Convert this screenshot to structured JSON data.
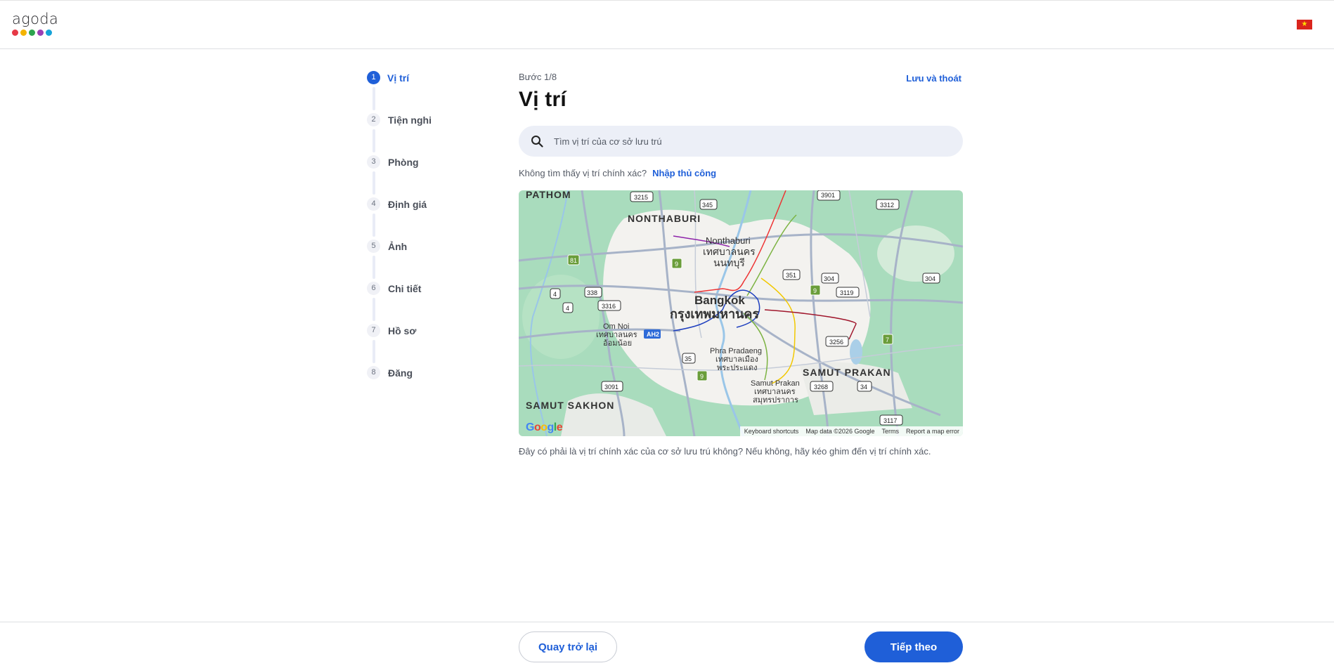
{
  "header": {
    "logo_text": "agoda",
    "logo_colors": [
      "#e63946",
      "#f4b400",
      "#2ea44f",
      "#9b3fb5",
      "#16a3d8"
    ],
    "flag": "vietnam-flag"
  },
  "stepper": {
    "steps": [
      {
        "num": "1",
        "label": "Vị trí",
        "active": true
      },
      {
        "num": "2",
        "label": "Tiện nghi"
      },
      {
        "num": "3",
        "label": "Phòng"
      },
      {
        "num": "4",
        "label": "Định giá"
      },
      {
        "num": "5",
        "label": "Ảnh"
      },
      {
        "num": "6",
        "label": "Chi tiết"
      },
      {
        "num": "7",
        "label": "Hồ sơ"
      },
      {
        "num": "8",
        "label": "Đăng"
      }
    ]
  },
  "main": {
    "step_counter": "Bước 1/8",
    "save_exit": "Lưu và thoát",
    "title": "Vị trí",
    "search_placeholder": "Tìm vị trí của cơ sở lưu trú",
    "not_found_text": "Không tìm thấy vị trí chính xác?",
    "manual_entry": "Nhập thủ công",
    "hint": "Đây có phải là vị trí chính xác của cơ sở lưu trú không? Nếu không, hãy kéo ghim đến vị trí chính xác."
  },
  "map": {
    "labels": {
      "pathom": "PATHOM",
      "nonthaburi_region": "NONTHABURI",
      "nonthaburi": "Nonthaburi",
      "nonthaburi_th1": "เทศบาลนคร",
      "nonthaburi_th2": "นนทบุรี",
      "bangkok": "Bangkok",
      "bangkok_th": "กรุงเทพมหานคร",
      "om_noi": "Om Noi",
      "om_noi_th1": "เทศบาลนคร",
      "om_noi_th2": "อ้อมน้อย",
      "phra_pradaeng": "Phra Pradaeng",
      "phra_pradaeng_th1": "เทศบาลเมือง",
      "phra_pradaeng_th2": "พระประแดง",
      "samut_prakan": "Samut Prakan",
      "samut_prakan_th1": "เทศบาลนคร",
      "samut_prakan_th2": "สมุทรปราการ",
      "samut_prakan_region": "SAMUT PRAKAN",
      "samut_sakhon": "SAMUT SAKHON"
    },
    "shields": {
      "r3215": "3215",
      "r345": "345",
      "r3901": "3901",
      "r3312": "3312",
      "r81": "81",
      "r9a": "9",
      "r351": "351",
      "r304a": "304",
      "r304b": "304",
      "r4a": "4",
      "r338": "338",
      "r3119": "3119",
      "r9b": "9",
      "r4b": "4",
      "r3316": "3316",
      "ah2": "AH2",
      "r3256": "3256",
      "r7": "7",
      "r35": "35",
      "r9c": "9",
      "r3091": "3091",
      "r3268": "3268",
      "r34": "34",
      "r3117": "3117"
    },
    "footer": {
      "shortcuts": "Keyboard shortcuts",
      "data": "Map data ©2026 Google",
      "terms": "Terms",
      "report": "Report a map error"
    },
    "google": "Google"
  },
  "footer": {
    "back": "Quay trở lại",
    "next": "Tiếp theo"
  }
}
